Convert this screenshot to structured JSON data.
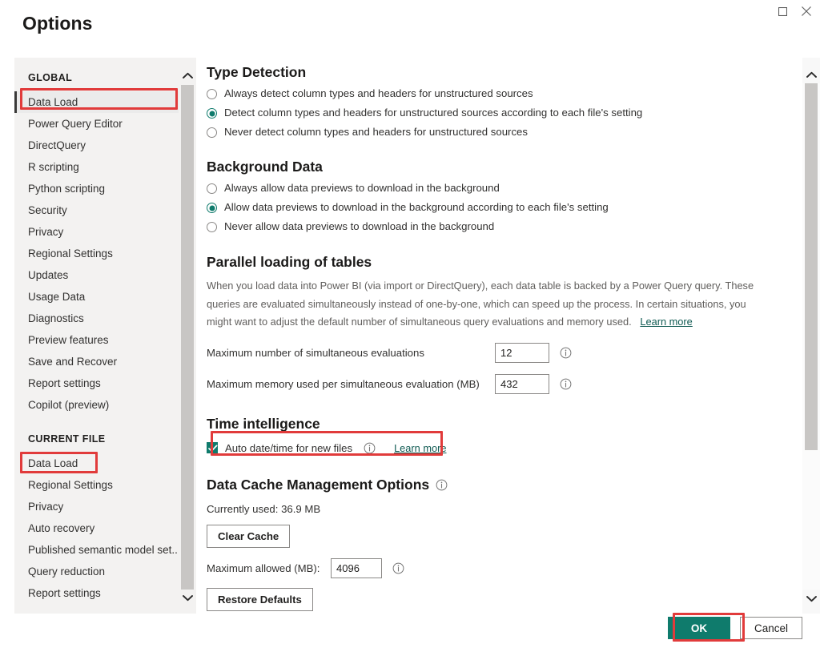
{
  "window": {
    "title": "Options",
    "maximize_icon": "maximize-icon",
    "close_icon": "close-icon"
  },
  "sidebar": {
    "groups": [
      {
        "label": "GLOBAL",
        "items": [
          {
            "label": "Data Load",
            "selected": true,
            "highlighted": true
          },
          {
            "label": "Power Query Editor",
            "selected": false
          },
          {
            "label": "DirectQuery",
            "selected": false
          },
          {
            "label": "R scripting",
            "selected": false
          },
          {
            "label": "Python scripting",
            "selected": false
          },
          {
            "label": "Security",
            "selected": false
          },
          {
            "label": "Privacy",
            "selected": false
          },
          {
            "label": "Regional Settings",
            "selected": false
          },
          {
            "label": "Updates",
            "selected": false
          },
          {
            "label": "Usage Data",
            "selected": false
          },
          {
            "label": "Diagnostics",
            "selected": false
          },
          {
            "label": "Preview features",
            "selected": false
          },
          {
            "label": "Save and Recover",
            "selected": false
          },
          {
            "label": "Report settings",
            "selected": false
          },
          {
            "label": "Copilot (preview)",
            "selected": false
          }
        ]
      },
      {
        "label": "CURRENT FILE",
        "items": [
          {
            "label": "Data Load",
            "selected": false,
            "highlighted": true
          },
          {
            "label": "Regional Settings",
            "selected": false
          },
          {
            "label": "Privacy",
            "selected": false
          },
          {
            "label": "Auto recovery",
            "selected": false
          },
          {
            "label": "Published semantic model set...",
            "selected": false
          },
          {
            "label": "Query reduction",
            "selected": false
          },
          {
            "label": "Report settings",
            "selected": false
          }
        ]
      }
    ],
    "scroll_up_icon": "chevron-up-icon",
    "scroll_down_icon": "chevron-down-icon"
  },
  "content": {
    "type_detection": {
      "title": "Type Detection",
      "options": [
        {
          "label": "Always detect column types and headers for unstructured sources",
          "checked": false
        },
        {
          "label": "Detect column types and headers for unstructured sources according to each file's setting",
          "checked": true
        },
        {
          "label": "Never detect column types and headers for unstructured sources",
          "checked": false
        }
      ]
    },
    "background_data": {
      "title": "Background Data",
      "options": [
        {
          "label": "Always allow data previews to download in the background",
          "checked": false
        },
        {
          "label": "Allow data previews to download in the background according to each file's setting",
          "checked": true
        },
        {
          "label": "Never allow data previews to download in the background",
          "checked": false
        }
      ]
    },
    "parallel_loading": {
      "title": "Parallel loading of tables",
      "description": "When you load data into Power BI (via import or DirectQuery), each data table is backed by a Power Query query. These queries are evaluated simultaneously instead of one-by-one, which can speed up the process. In certain situations, you might want to adjust the default number of simultaneous query evaluations and memory used.",
      "learn_more": "Learn more",
      "fields": [
        {
          "label": "Maximum number of simultaneous evaluations",
          "value": "12",
          "info_icon": "info-icon"
        },
        {
          "label": "Maximum memory used per simultaneous evaluation (MB)",
          "value": "432",
          "info_icon": "info-icon"
        }
      ]
    },
    "time_intelligence": {
      "title": "Time intelligence",
      "checkbox_label": "Auto date/time for new files",
      "checked": true,
      "info_icon": "info-icon",
      "learn_more": "Learn more"
    },
    "data_cache": {
      "title": "Data Cache Management Options",
      "info_icon": "info-icon",
      "currently_used": "Currently used: 36.9 MB",
      "clear_cache_label": "Clear Cache",
      "max_allowed_label": "Maximum allowed (MB):",
      "max_allowed_value": "4096",
      "restore_defaults_label": "Restore Defaults"
    },
    "scroll_up_icon": "chevron-up-icon",
    "scroll_down_icon": "chevron-down-icon"
  },
  "footer": {
    "ok_label": "OK",
    "cancel_label": "Cancel"
  },
  "colors": {
    "accent_green": "#0f7b6c",
    "annotation_red": "#e13b3b",
    "sidebar_bg": "#f3f2f1",
    "link": "#0f5a52"
  }
}
